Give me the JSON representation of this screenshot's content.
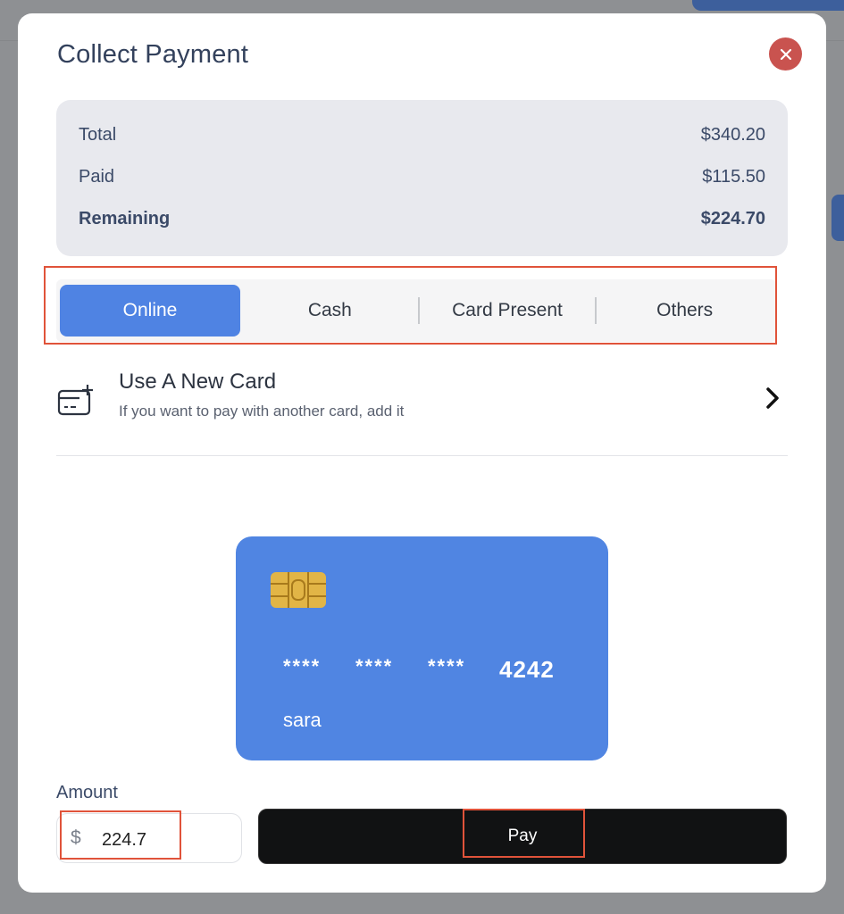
{
  "modal": {
    "title": "Collect Payment"
  },
  "summary": {
    "rows": [
      {
        "label": "Total",
        "value": "$340.20"
      },
      {
        "label": "Paid",
        "value": "$115.50"
      },
      {
        "label": "Remaining",
        "value": "$224.70"
      }
    ]
  },
  "tabs": [
    {
      "label": "Online",
      "active": true
    },
    {
      "label": "Cash",
      "active": false
    },
    {
      "label": "Card Present",
      "active": false
    },
    {
      "label": "Others",
      "active": false
    }
  ],
  "new_card": {
    "title": "Use A New Card",
    "subtitle": "If you want to pay with another card, add it",
    "icon": "card-plus-icon"
  },
  "card": {
    "stars": [
      "****",
      "****",
      "****"
    ],
    "last4": "4242",
    "holder": "sara"
  },
  "amount": {
    "label": "Amount",
    "currency": "$",
    "value": "224.7"
  },
  "pay_button": {
    "label": "Pay"
  },
  "colors": {
    "accent": "#4f83e3",
    "close": "#c9534f",
    "highlight": "#e0533a",
    "pay": "#111213"
  }
}
